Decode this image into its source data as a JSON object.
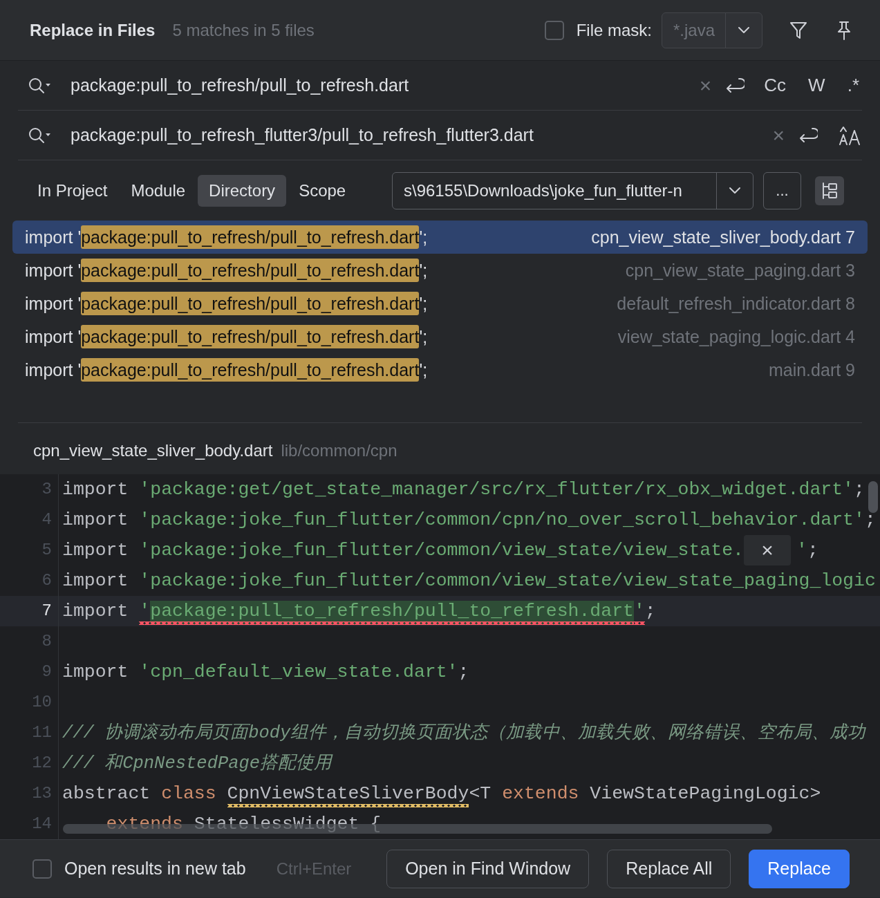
{
  "header": {
    "title": "Replace in Files",
    "match_count": "5 matches in 5 files",
    "file_mask": {
      "label": "File mask:",
      "checked": false,
      "value": "*.java",
      "disabled": true
    }
  },
  "find": {
    "value": "package:pull_to_refresh/pull_to_refresh.dart",
    "clear": "×",
    "toggles": [
      {
        "label": "Cc",
        "selected": false
      },
      {
        "label": "W",
        "selected": false
      },
      {
        "label": ".*",
        "selected": false
      }
    ]
  },
  "replace": {
    "value": "package:pull_to_refresh_flutter3/pull_to_refresh_flutter3.dart",
    "clear": "×"
  },
  "scope": {
    "tabs": [
      {
        "label": "In Project",
        "selected": false
      },
      {
        "label": "Module",
        "selected": false
      },
      {
        "label": "Directory",
        "selected": true
      },
      {
        "label": "Scope",
        "selected": false
      }
    ],
    "directory": "s\\96155\\Downloads\\joke_fun_flutter-n",
    "browse": "..."
  },
  "results": [
    {
      "prefix": "import '",
      "match": "package:pull_to_refresh/pull_to_refresh.dart",
      "suffix": "';",
      "file": "cpn_view_state_sliver_body.dart",
      "line": "7",
      "selected": true
    },
    {
      "prefix": "import '",
      "match": "package:pull_to_refresh/pull_to_refresh.dart",
      "suffix": "';",
      "file": "cpn_view_state_paging.dart",
      "line": "3",
      "selected": false
    },
    {
      "prefix": "import '",
      "match": "package:pull_to_refresh/pull_to_refresh.dart",
      "suffix": "';",
      "file": "default_refresh_indicator.dart",
      "line": "8",
      "selected": false
    },
    {
      "prefix": "import '",
      "match": "package:pull_to_refresh/pull_to_refresh.dart",
      "suffix": "';",
      "file": "view_state_paging_logic.dart",
      "line": "4",
      "selected": false
    },
    {
      "prefix": "import '",
      "match": "package:pull_to_refresh/pull_to_refresh.dart",
      "suffix": "';",
      "file": "main.dart",
      "line": "9",
      "selected": false
    }
  ],
  "preview": {
    "file": "cpn_view_state_sliver_body.dart",
    "path": "lib/common/cpn"
  },
  "editor": {
    "lines": [
      {
        "number": "3",
        "current": false,
        "tokens": [
          {
            "kind": "plain",
            "text": "import "
          },
          {
            "kind": "string",
            "text": "'package:get/get_state_manager/src/rx_flutter/rx_obx_widget.dart'"
          },
          {
            "kind": "plain",
            "text": ";"
          }
        ]
      },
      {
        "number": "4",
        "current": false,
        "tokens": [
          {
            "kind": "plain",
            "text": "import "
          },
          {
            "kind": "string",
            "text": "'package:joke_fun_flutter/common/cpn/no_over_scroll_behavior.dart'"
          },
          {
            "kind": "plain",
            "text": ";"
          }
        ]
      },
      {
        "number": "5",
        "current": false,
        "tokens": [
          {
            "kind": "plain",
            "text": "import "
          },
          {
            "kind": "string",
            "text": "'package:joke_fun_flutter/common/view_state/view_state."
          },
          {
            "kind": "popup",
            "text": "×"
          },
          {
            "kind": "string",
            "text": "'"
          },
          {
            "kind": "plain",
            "text": ";"
          }
        ]
      },
      {
        "number": "6",
        "current": false,
        "tokens": [
          {
            "kind": "plain",
            "text": "import "
          },
          {
            "kind": "string",
            "text": "'package:joke_fun_flutter/common/view_state/view_state_paging_logic"
          }
        ]
      },
      {
        "number": "7",
        "current": true,
        "tokens": [
          {
            "kind": "plain",
            "text": "import "
          },
          {
            "kind": "string",
            "text": "'",
            "error": true
          },
          {
            "kind": "match",
            "text": "package:pull_to_refresh/pull_to_refresh.dart",
            "error": true
          },
          {
            "kind": "string",
            "text": "'",
            "error": true
          },
          {
            "kind": "plain",
            "text": ";"
          }
        ]
      },
      {
        "number": "8",
        "current": false
      },
      {
        "number": "9",
        "current": false,
        "tokens": [
          {
            "kind": "plain",
            "text": "import "
          },
          {
            "kind": "string",
            "text": "'cpn_default_view_state.dart'"
          },
          {
            "kind": "plain",
            "text": ";"
          }
        ]
      },
      {
        "number": "10",
        "current": false
      },
      {
        "number": "11",
        "current": false,
        "tokens": [
          {
            "kind": "comment",
            "text": "/// 协调滚动布局页面body组件，自动切换页面状态（加载中、加载失败、网络错误、空布局、成功"
          }
        ]
      },
      {
        "number": "12",
        "current": false,
        "tokens": [
          {
            "kind": "comment",
            "text": "/// 和CpnNestedPage搭配使用"
          }
        ]
      },
      {
        "number": "13",
        "current": false,
        "tokens": [
          {
            "kind": "plain",
            "text": "abstract "
          },
          {
            "kind": "keyword",
            "text": "class "
          },
          {
            "kind": "plain",
            "text": "CpnViewStateSliverBody",
            "warning": true
          },
          {
            "kind": "plain",
            "text": "<T "
          },
          {
            "kind": "keyword",
            "text": "extends "
          },
          {
            "kind": "plain",
            "text": "ViewStatePagingLogic>"
          }
        ]
      },
      {
        "number": "14",
        "current": false,
        "tokens": [
          {
            "kind": "keyword",
            "text": "    extends "
          },
          {
            "kind": "plain",
            "text": "StatelessWidget {"
          }
        ]
      }
    ]
  },
  "footer": {
    "new_tab": {
      "label": "Open results in new tab",
      "checked": false
    },
    "shortcut": "Ctrl+Enter",
    "buttons": [
      {
        "label": "Open in Find Window",
        "kind": "secondary"
      },
      {
        "label": "Replace All",
        "kind": "secondary"
      },
      {
        "label": "Replace",
        "kind": "primary"
      }
    ]
  }
}
